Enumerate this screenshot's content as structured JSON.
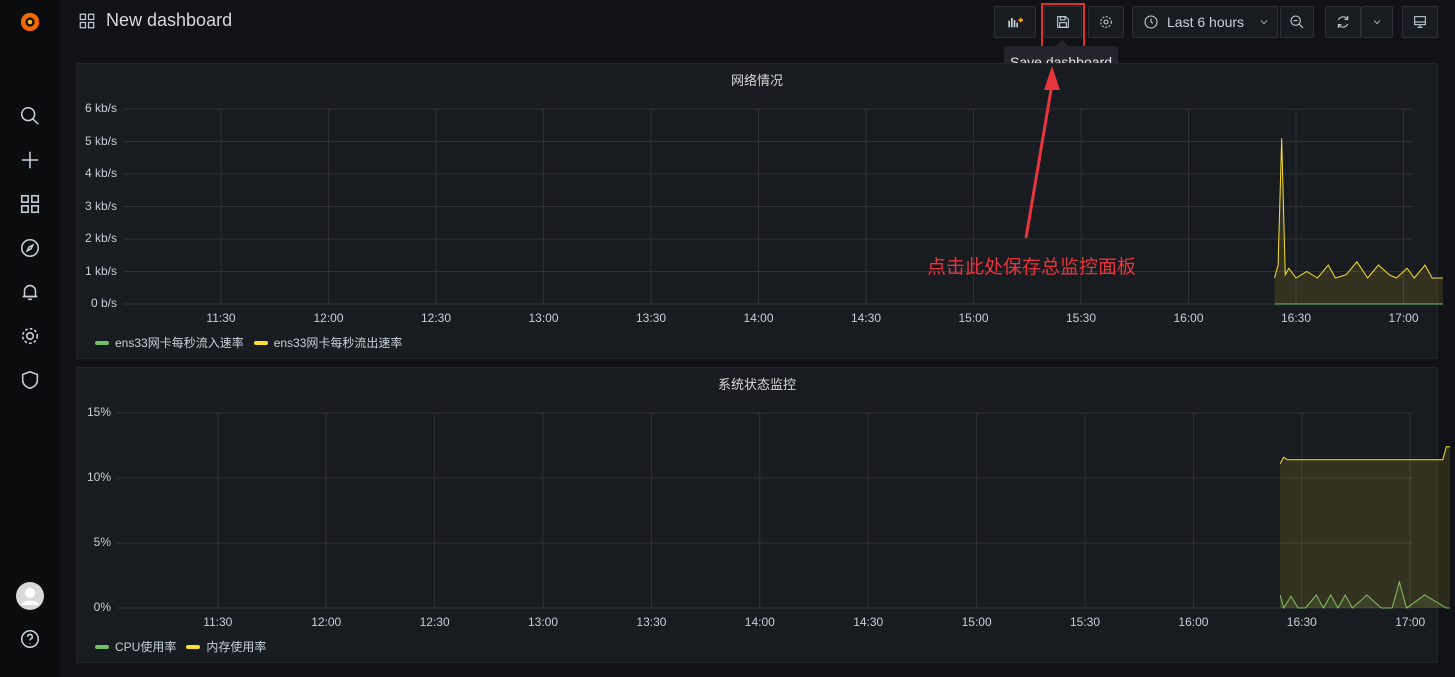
{
  "sidebar": {
    "items": [
      {
        "icon": "grafana-logo-icon"
      },
      {
        "icon": "search-icon"
      },
      {
        "icon": "plus-icon"
      },
      {
        "icon": "dashboards-icon"
      },
      {
        "icon": "explore-icon"
      },
      {
        "icon": "bell-icon"
      },
      {
        "icon": "gear-icon"
      },
      {
        "icon": "shield-icon"
      },
      {
        "icon": "avatar-icon"
      },
      {
        "icon": "help-icon"
      }
    ]
  },
  "header": {
    "title": "New dashboard",
    "time_range_label": "Last 6 hours",
    "tooltip": "Save dashboard"
  },
  "annotation": {
    "text": "点击此处保存总监控面板",
    "color": "#e8353b"
  },
  "panels": [
    {
      "title": "网络情况",
      "legend": [
        {
          "label": "ens33网卡每秒流入速率",
          "color": "#73bf69"
        },
        {
          "label": "ens33网卡每秒流出速率",
          "color": "#fade2a"
        }
      ]
    },
    {
      "title": "系统状态监控",
      "legend": [
        {
          "label": "CPU使用率",
          "color": "#73bf69"
        },
        {
          "label": "内存使用率",
          "color": "#fade2a"
        }
      ]
    }
  ],
  "chart_data": [
    {
      "type": "line",
      "title": "网络情况",
      "y_tick_labels": [
        "6 kb/s",
        "5 kb/s",
        "4 kb/s",
        "3 kb/s",
        "2 kb/s",
        "1 kb/s",
        "0 b/s"
      ],
      "x_tick_labels": [
        "11:30",
        "12:00",
        "12:30",
        "13:00",
        "13:30",
        "14:00",
        "14:30",
        "15:00",
        "15:30",
        "16:00",
        "16:30",
        "17:00"
      ],
      "ylim": [
        0,
        6
      ],
      "yunit": "kb/s",
      "series": [
        {
          "name": "ens33网卡每秒流入速率",
          "color": "#73bf69",
          "x": [
            "16:24",
            "17:11"
          ],
          "values": [
            0,
            0
          ]
        },
        {
          "name": "ens33网卡每秒流出速率",
          "color": "#fade2a",
          "x": [
            "16:24",
            "16:25",
            "16:26",
            "16:27",
            "16:28",
            "16:30",
            "16:33",
            "16:36",
            "16:39",
            "16:41",
            "16:44",
            "16:47",
            "16:50",
            "16:53",
            "16:56",
            "16:58",
            "17:01",
            "17:03",
            "17:06",
            "17:08",
            "17:11"
          ],
          "values": [
            0.8,
            1.2,
            5.1,
            0.9,
            1.1,
            0.8,
            1.0,
            0.8,
            1.2,
            0.8,
            0.9,
            1.3,
            0.8,
            1.2,
            0.9,
            0.8,
            1.1,
            0.8,
            1.2,
            0.8,
            0.8
          ]
        }
      ]
    },
    {
      "type": "area",
      "title": "系统状态监控",
      "y_tick_labels": [
        "15%",
        "10%",
        "5%",
        "0%"
      ],
      "x_tick_labels": [
        "11:30",
        "12:00",
        "12:30",
        "13:00",
        "13:30",
        "14:00",
        "14:30",
        "15:00",
        "15:30",
        "16:00",
        "16:30",
        "17:00"
      ],
      "ylim": [
        0,
        15
      ],
      "yunit": "%",
      "series": [
        {
          "name": "CPU使用率",
          "color": "#73bf69",
          "x": [
            "16:24",
            "16:25",
            "16:27",
            "16:29",
            "16:31",
            "16:34",
            "16:36",
            "16:38",
            "16:40",
            "16:42",
            "16:44",
            "16:48",
            "16:52",
            "16:55",
            "16:57",
            "16:59",
            "17:04",
            "17:10",
            "17:11"
          ],
          "values": [
            1.0,
            0,
            0.9,
            0,
            0,
            1.0,
            0,
            1.0,
            0,
            1.0,
            0,
            1.0,
            0,
            0,
            2.0,
            0,
            1.0,
            0,
            0
          ]
        },
        {
          "name": "内存使用率",
          "color": "#fade2a",
          "x": [
            "16:24",
            "16:25",
            "16:26",
            "16:28",
            "16:40",
            "17:00",
            "17:09",
            "17:10",
            "17:11"
          ],
          "values": [
            11.1,
            11.6,
            11.4,
            11.4,
            11.4,
            11.4,
            11.4,
            12.4,
            12.4
          ]
        }
      ]
    }
  ]
}
